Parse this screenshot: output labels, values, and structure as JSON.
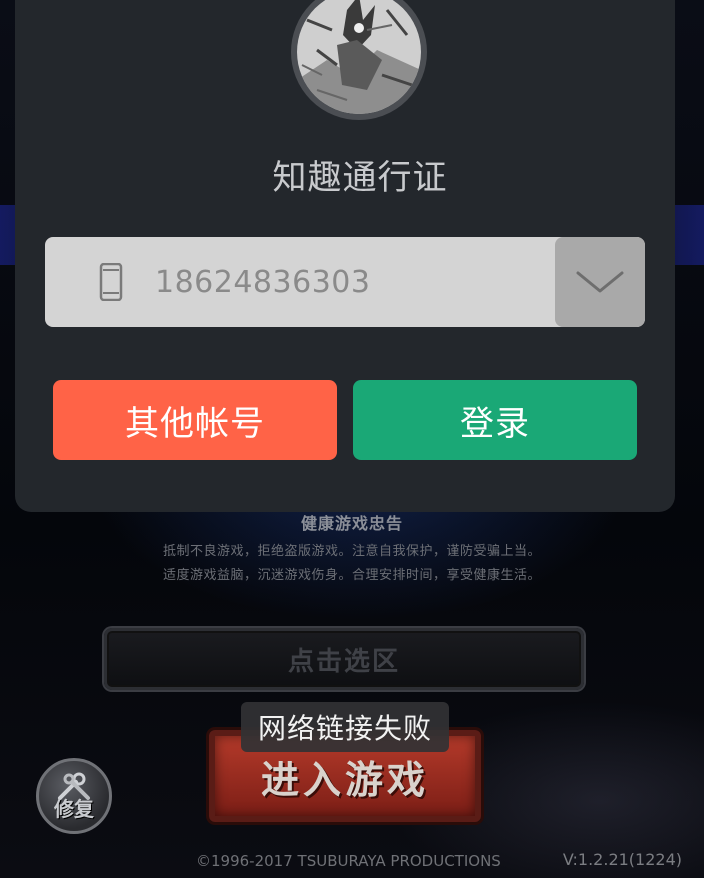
{
  "dialog": {
    "title": "知趣通行证",
    "account_value": "18624836303",
    "other_account_label": "其他帐号",
    "login_label": "登录"
  },
  "background": {
    "health_title": "健康游戏忠告",
    "health_line1": "抵制不良游戏，拒绝盗版游戏。注意自我保护，谨防受骗上当。",
    "health_line2": "适度游戏益脑，沉迷游戏伤身。合理安排时间，享受健康生活。",
    "server_select_label": "点击选区",
    "enter_game_label": "进入游戏",
    "repair_label": "修复",
    "copyright": "©1996-2017 TSUBURAYA PRODUCTIONS",
    "version": "V:1.2.21(1224)"
  },
  "toast": {
    "message": "网络链接失败"
  },
  "colors": {
    "dialog_bg": "#23272c",
    "other_account_button": "#ff6347",
    "login_button": "#1aa876",
    "field_bg": "#d4d4d4",
    "dropdown_bg": "#a9a9a9"
  },
  "icons": {
    "phone": "phone-icon",
    "dropdown": "chevron-down-icon",
    "repair": "wrench-icon",
    "avatar": "hero-avatar"
  }
}
